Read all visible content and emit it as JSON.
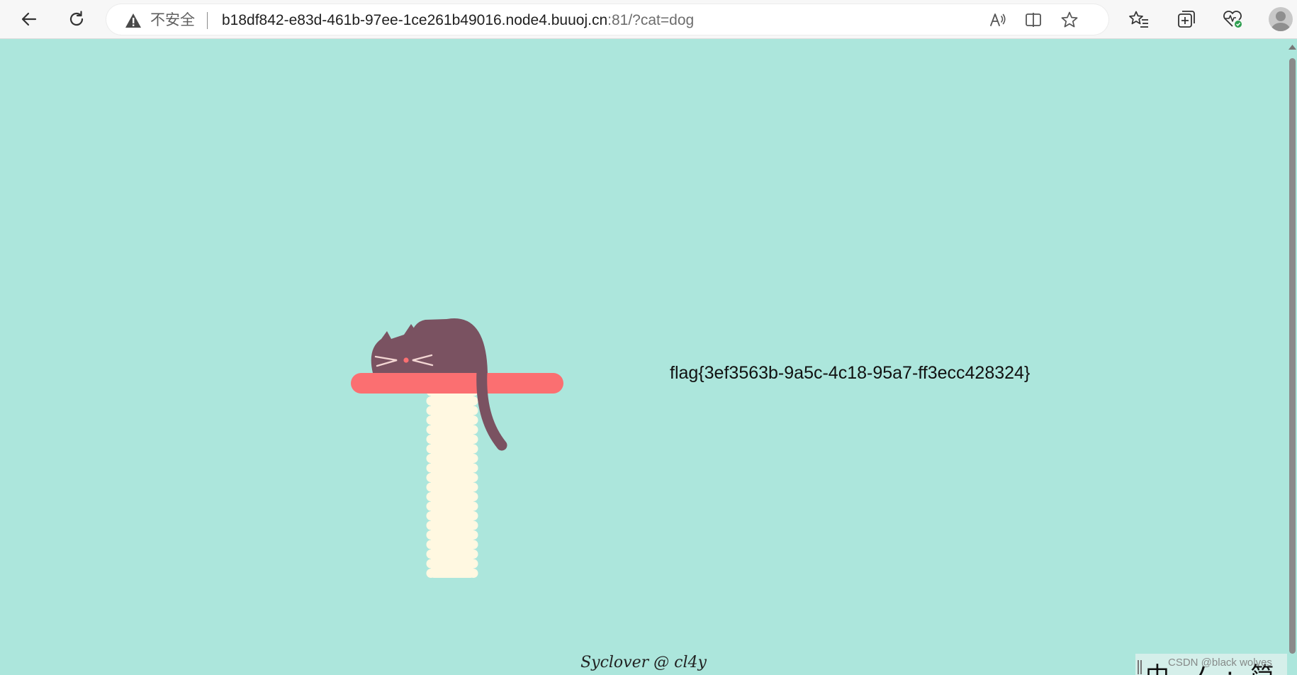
{
  "browser": {
    "security_label": "不安全",
    "url_host": "b18df842-e83d-461b-97ee-1ce261b49016.node4.buuoj.cn",
    "url_rest": ":81/?cat=dog"
  },
  "page": {
    "flag_text": "flag{3ef3563b-9a5c-4c18-95a7-ff3ecc428324}",
    "footer_text": "Syclover @ cl4y",
    "background_color": "#ace6dc"
  },
  "overlay": {
    "ime_text": "中 ノ ; 简 ⚙",
    "watermark": "CSDN @black wolves"
  },
  "colors": {
    "cat": "#7a5261",
    "perch": "#fb6f71",
    "post": "#fff8e1"
  }
}
